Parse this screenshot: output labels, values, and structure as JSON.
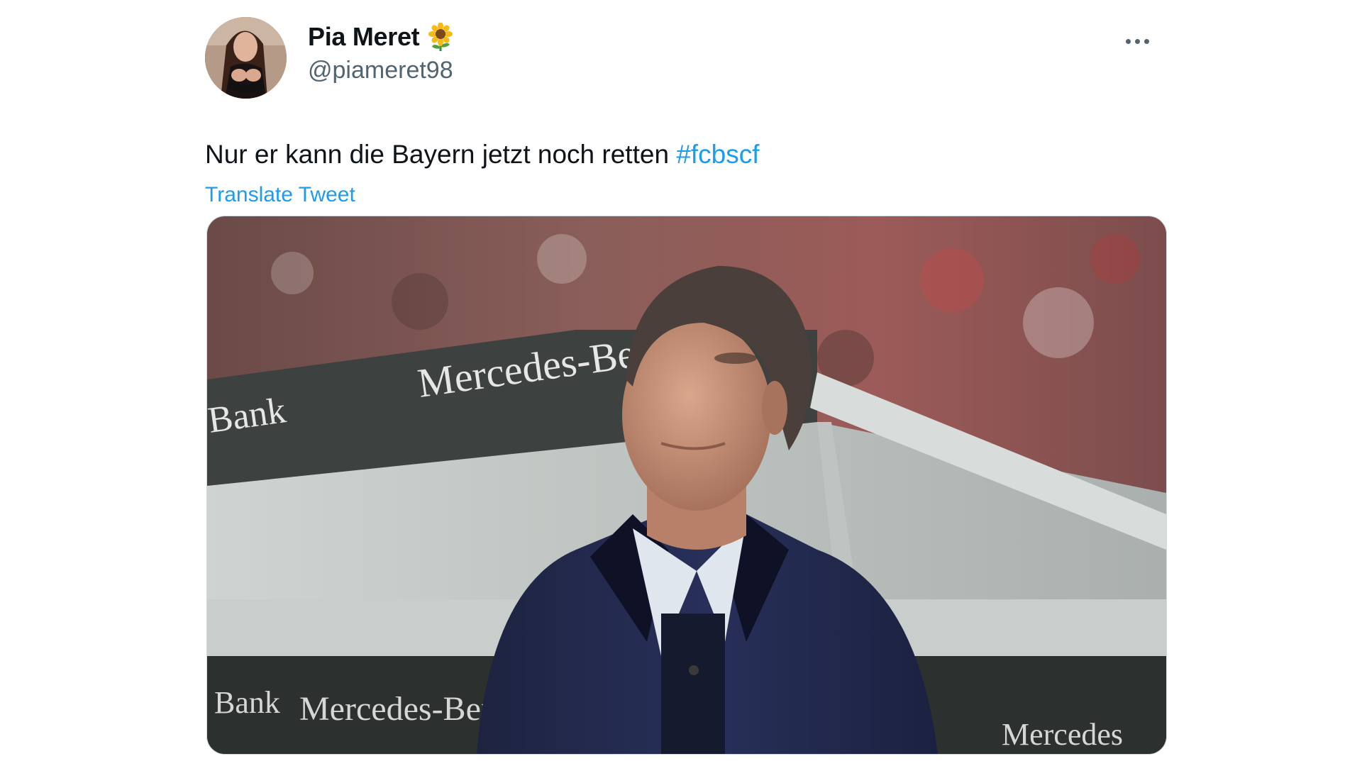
{
  "tweet": {
    "display_name": "Pia Meret",
    "name_emoji": "sunflower-emoji",
    "handle": "@piameret98",
    "text_plain": "Nur er kann die Bayern jetzt noch retten ",
    "hashtag": "#fcbscf",
    "translate_label": "Translate Tweet",
    "more_icon": "more-horizontal-icon"
  },
  "photo": {
    "board_text_upper": "Mercedes-Be",
    "board_text_upper_left": "Bank",
    "board_text_lower": "Mercedes-Benz B",
    "board_text_lower_left": "Bank",
    "board_text_lower_right": "Mercedes"
  },
  "colors": {
    "text_primary": "#0f1419",
    "text_secondary": "#536471",
    "link": "#1d9bf0"
  }
}
